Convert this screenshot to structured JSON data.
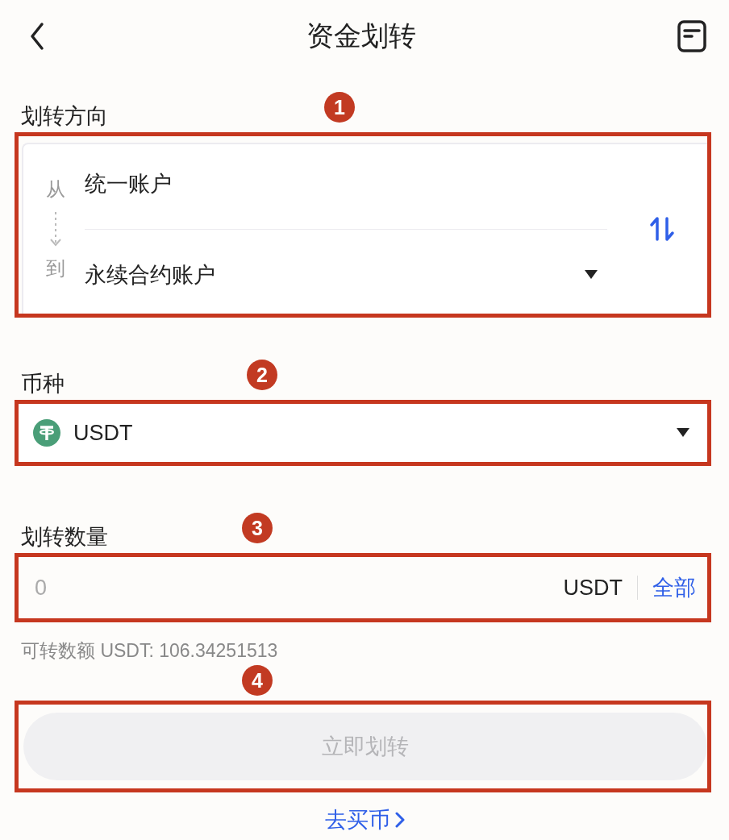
{
  "header": {
    "title": "资金划转"
  },
  "direction": {
    "label": "划转方向",
    "from_label": "从",
    "from_account": "统一账户",
    "to_label": "到",
    "to_account": "永续合约账户"
  },
  "coin": {
    "label": "币种",
    "value": "USDT"
  },
  "amount": {
    "label": "划转数量",
    "placeholder": "0",
    "unit": "USDT",
    "max_link": "全部",
    "available": "可转数额 USDT: 106.34251513"
  },
  "submit": {
    "label": "立即划转",
    "disabled": true
  },
  "buy_link": "去买币",
  "annotations": [
    {
      "label": "1"
    },
    {
      "label": "2"
    },
    {
      "label": "3"
    },
    {
      "label": "4"
    }
  ]
}
